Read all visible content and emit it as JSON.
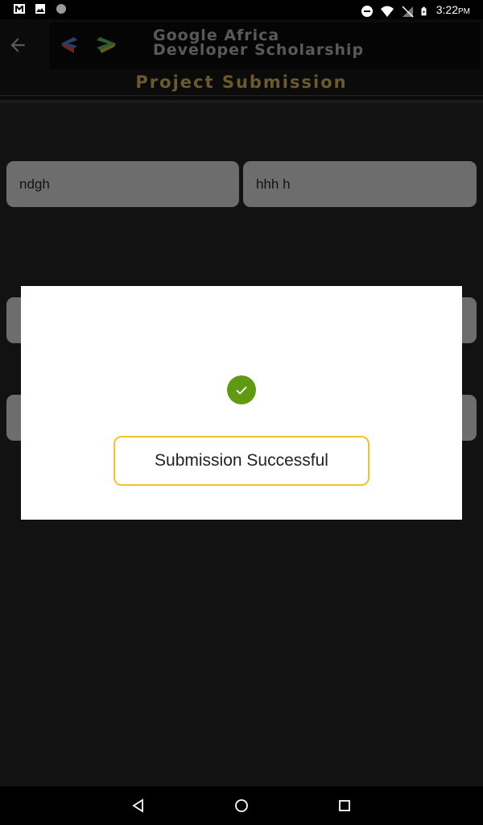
{
  "status_bar": {
    "time": "3:22",
    "ampm": "PM",
    "left_icons": [
      "gmail-icon",
      "image-icon",
      "dot-icon"
    ],
    "right_icons": [
      "do-not-disturb-icon",
      "wifi-icon",
      "no-sim-icon",
      "battery-icon"
    ]
  },
  "header": {
    "banner_line1": "Google Africa",
    "banner_line2": "Developer Scholarship",
    "subtitle": "Project Submission",
    "back_icon": "arrow-back-icon"
  },
  "form": {
    "first_name": "ndgh",
    "last_name": "hhh h"
  },
  "dialog": {
    "icon": "check-circle-icon",
    "message": "Submission Successful",
    "icon_color": "#5f9a12",
    "border_color": "#f2c12e"
  },
  "nav_bar": {
    "buttons": [
      "back-triangle-icon",
      "home-circle-icon",
      "recents-square-icon"
    ]
  }
}
